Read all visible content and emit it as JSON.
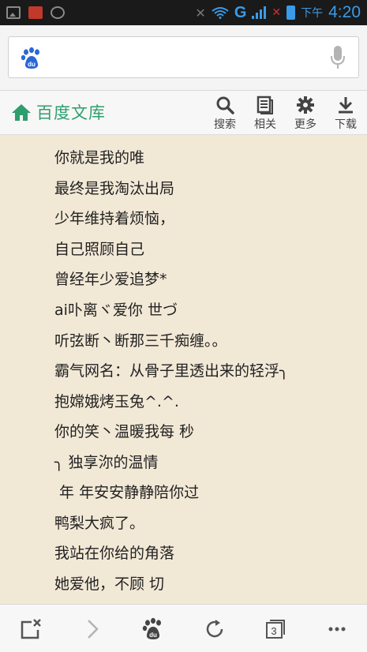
{
  "status_bar": {
    "network": "G",
    "ampm": "下午",
    "time": "4:20",
    "icons": [
      "gallery-icon",
      "app-notification-icon",
      "shield-icon",
      "mute-icon",
      "wifi-icon",
      "signal-icon",
      "no-sim-icon",
      "battery-icon"
    ]
  },
  "search": {
    "placeholder": "",
    "logo_icon": "baidu-paw-icon",
    "voice_icon": "microphone-icon"
  },
  "wenku": {
    "title": "百度文库",
    "home_icon": "home-icon",
    "tools": [
      {
        "label": "搜索",
        "icon": "search-icon"
      },
      {
        "label": "相关",
        "icon": "document-icon"
      },
      {
        "label": "更多",
        "icon": "gear-icon"
      },
      {
        "label": "下载",
        "icon": "download-icon"
      }
    ]
  },
  "document": {
    "lines": [
      "你就是我的唯",
      "最终是我淘汰出局",
      "少年维持着烦恼，",
      "自己照顾自己",
      "曾经年少爱追梦*",
      "ai卟离ヾ爱你 世づ",
      "听弦断丶断那三千痴缠。。",
      "霸气网名：从骨子里透出来的轻浮╮",
      "抱嫦娥烤玉兔^.^.",
      "你的笑丶温暖我每 秒",
      "╮ 独享沵的温情",
      " 年 年安安静静陪你过",
      "鸭梨大疯了。",
      "我站在你给的角落",
      "她爱他，不顾 切"
    ]
  },
  "bottom_nav": {
    "tab_count": "3",
    "icons": [
      "close-page-icon",
      "forward-icon",
      "baidu-home-icon",
      "refresh-icon",
      "tabs-icon",
      "menu-icon"
    ]
  },
  "colors": {
    "accent": "#2e9e6e",
    "page_bg": "#f2e8d6",
    "status_blue": "#3a9be8"
  }
}
